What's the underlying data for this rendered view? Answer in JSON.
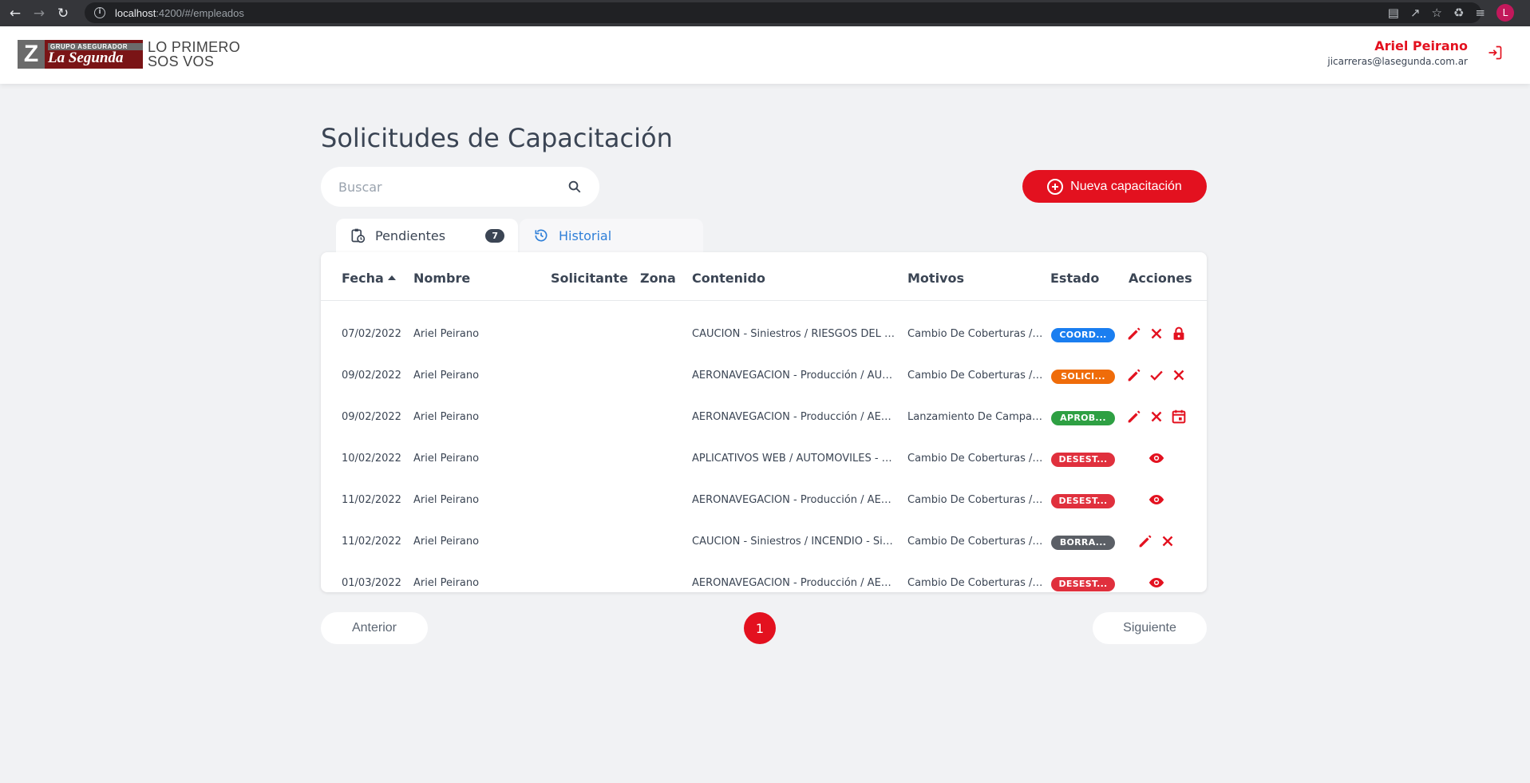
{
  "browser": {
    "url_host": "localhost",
    "url_path": ":4200/#/empleados",
    "profile_initial": "L"
  },
  "header": {
    "logo_group": "GRUPO ASEGURADOR",
    "logo_brand": "La Segunda",
    "slogan_line1": "LO PRIMERO",
    "slogan_line2": "SOS VOS",
    "user_name": "Ariel Peirano",
    "user_email": "jicarreras@lasegunda.com.ar"
  },
  "page": {
    "title": "Solicitudes de Capacitación",
    "search_placeholder": "Buscar",
    "new_button_label": "Nueva capacitación"
  },
  "tabs": [
    {
      "label": "Pendientes",
      "count": "7",
      "active": true
    },
    {
      "label": "Historial",
      "active": false
    }
  ],
  "table": {
    "columns": [
      "Fecha",
      "Nombre",
      "Solicitante",
      "Zona",
      "Contenido",
      "Motivos",
      "Estado",
      "Acciones"
    ],
    "rows": [
      {
        "fecha": "07/02/2022",
        "nombre": "Ariel Peirano",
        "solicitante": "",
        "zona": "",
        "contenido": "CAUCIÓN - Siniestros / RIESGOS DEL TR...",
        "motivos": "Cambio De Coberturas / ...",
        "estado": "COORD...",
        "estado_color": "#1a7ef0",
        "acciones": [
          "edit",
          "close",
          "lock"
        ]
      },
      {
        "fecha": "09/02/2022",
        "nombre": "Ariel Peirano",
        "solicitante": "",
        "zona": "",
        "contenido": "AERONAVEGACIÓN - Producción / AUTO...",
        "motivos": "Cambio De Coberturas / ...",
        "estado": "SOLICI...",
        "estado_color": "#ef6c0a",
        "acciones": [
          "edit",
          "check",
          "close"
        ]
      },
      {
        "fecha": "09/02/2022",
        "nombre": "Ariel Peirano",
        "solicitante": "",
        "zona": "",
        "contenido": "AERONAVEGACIÓN - Producción / AERO...",
        "motivos": "Lanzamiento De Campañ...",
        "estado": "APROB...",
        "estado_color": "#2ea043",
        "acciones": [
          "edit",
          "close",
          "calendar"
        ]
      },
      {
        "fecha": "10/02/2022",
        "nombre": "Ariel Peirano",
        "solicitante": "",
        "zona": "",
        "contenido": "APLICATIVOS WEB / AUTOMÓVILES - Sini...",
        "motivos": "Cambio De Coberturas / ...",
        "estado": "DESEST...",
        "estado_color": "#e0303d",
        "acciones": [
          "view"
        ]
      },
      {
        "fecha": "11/02/2022",
        "nombre": "Ariel Peirano",
        "solicitante": "",
        "zona": "",
        "contenido": "AERONAVEGACIÓN - Producción / AERO...",
        "motivos": "Cambio De Coberturas / L...",
        "estado": "DESEST...",
        "estado_color": "#e0303d",
        "acciones": [
          "view"
        ]
      },
      {
        "fecha": "11/02/2022",
        "nombre": "Ariel Peirano",
        "solicitante": "",
        "zona": "",
        "contenido": "CAUCIÓN - Siniestros / INCENDIO - Sinie...",
        "motivos": "Cambio De Coberturas / ...",
        "estado": "BORRA...",
        "estado_color": "#5b5f66",
        "acciones": [
          "edit",
          "close"
        ]
      },
      {
        "fecha": "01/03/2022",
        "nombre": "Ariel Peirano",
        "solicitante": "",
        "zona": "",
        "contenido": "AERONAVEGACIÓN - Producción / AERO...",
        "motivos": "Cambio De Coberturas / L...",
        "estado": "DESEST...",
        "estado_color": "#e0303d",
        "acciones": [
          "view"
        ]
      }
    ]
  },
  "pagination": {
    "prev_label": "Anterior",
    "current_page": "1",
    "next_label": "Siguiente"
  },
  "colors": {
    "accent": "#e3111f",
    "text": "#3b4554",
    "background": "#f1f2f4"
  }
}
